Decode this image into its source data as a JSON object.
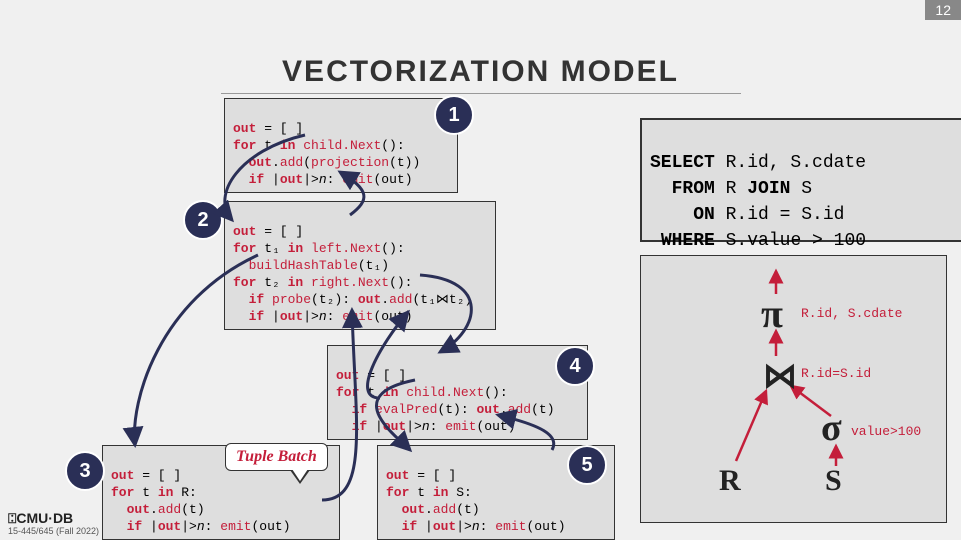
{
  "slide_number": "12",
  "title": "VECTORIZATION MODEL",
  "box1": {
    "l1": "out = [ ]",
    "l2": "for t in child.Next():",
    "l3": "  out.add(projection(t))",
    "l4": "  if |out|>n: emit(out)"
  },
  "box2": {
    "l1": "out = [ ]",
    "l2": "for t₁ in left.Next():",
    "l3": "  buildHashTable(t₁)",
    "l4": "for t₂ in right.Next():",
    "l5": "  if probe(t₂): out.add(t₁⋈t₂)",
    "l6": "  if |out|>n: emit(out)"
  },
  "box3": {
    "l1": "out = [ ]",
    "l2": "for t in R:",
    "l3": "  out.add(t)",
    "l4": "  if |out|>n: emit(out)"
  },
  "box4": {
    "l1": "out = [ ]",
    "l2": "for t in child.Next():",
    "l3": "  if evalPred(t): out.add(t)",
    "l4": "  if |out|>n: emit(out)"
  },
  "box5": {
    "l1": "out = [ ]",
    "l2": "for t in S:",
    "l3": "  out.add(t)",
    "l4": "  if |out|>n: emit(out)"
  },
  "badges": {
    "b1": "1",
    "b2": "2",
    "b3": "3",
    "b4": "4",
    "b5": "5"
  },
  "sql": {
    "l1": "SELECT R.id, S.cdate",
    "l2": "  FROM R JOIN S",
    "l3": "    ON R.id = S.id",
    "l4": " WHERE S.value > 100"
  },
  "tree": {
    "pi": "π",
    "join": "⋈",
    "sigma": "σ",
    "R": "R",
    "S": "S",
    "pi_lbl": "R.id, S.cdate",
    "join_lbl": "R.id=S.id",
    "sigma_lbl": "value>100"
  },
  "speech": "Tuple Batch",
  "logo": "⍠CMU·DB",
  "footer": "15-445/645 (Fall 2022)"
}
